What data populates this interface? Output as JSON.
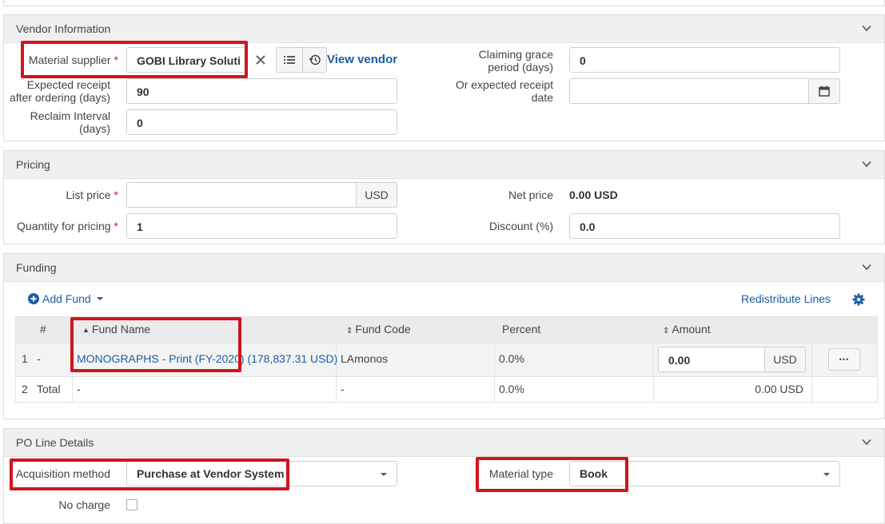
{
  "vendor": {
    "title": "Vendor Information",
    "supplier_label": "Material supplier",
    "supplier_value": "GOBI Library Solutio",
    "view_vendor": "View vendor",
    "claiming_label_1": "Claiming grace",
    "claiming_label_2": "period (days)",
    "claiming_value": "0",
    "expected_label_1": "Expected receipt",
    "expected_label_2": "after ordering (days)",
    "expected_value": "90",
    "or_expected_label_1": "Or expected receipt",
    "or_expected_label_2": "date",
    "or_expected_value": "",
    "reclaim_label_1": "Reclaim Interval",
    "reclaim_label_2": "(days)",
    "reclaim_value": "0"
  },
  "pricing": {
    "title": "Pricing",
    "list_price_label": "List price",
    "list_price_value": "",
    "currency": "USD",
    "net_price_label": "Net price",
    "net_price_value": "0.00 USD",
    "quantity_label": "Quantity for pricing",
    "quantity_value": "1",
    "discount_label": "Discount (%)",
    "discount_value": "0.0"
  },
  "funding": {
    "title": "Funding",
    "add_fund": "Add Fund",
    "redistribute": "Redistribute Lines",
    "columns": [
      "#",
      "Fund Name",
      "Fund Code",
      "Percent",
      "Amount"
    ],
    "row1": {
      "num": "1",
      "dash": "-",
      "fund_name": "MONOGRAPHS - Print (FY-2020)",
      "fund_balance": "(178,837.31 USD)",
      "code": "LAmonos",
      "percent": "0.0%",
      "amount": "0.00",
      "currency": "USD",
      "more": "•••"
    },
    "total": {
      "num": "2",
      "label": "Total",
      "name": "-",
      "code": "-",
      "percent": "0.0%",
      "amount": "0.00 USD"
    }
  },
  "po_line": {
    "title": "PO Line Details",
    "acq_label": "Acquisition method",
    "acq_value": "Purchase at Vendor System",
    "material_label": "Material type",
    "material_value": "Book",
    "no_charge_label": "No charge"
  },
  "colors": {
    "highlight": "#d0141c",
    "link": "#1b5ea8",
    "required": "#c81d1d"
  }
}
